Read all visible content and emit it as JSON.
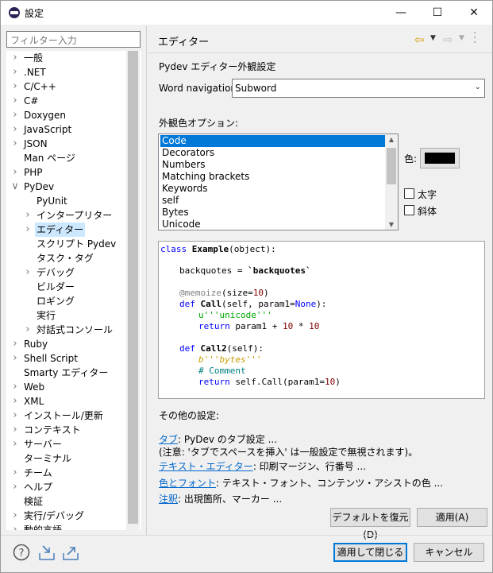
{
  "window": {
    "title": "設定"
  },
  "filter": {
    "placeholder": "フィルター入力"
  },
  "tree": [
    {
      "label": "一般",
      "arrow": ">",
      "indent": 0
    },
    {
      "label": ".NET",
      "arrow": ">",
      "indent": 0
    },
    {
      "label": "C/C++",
      "arrow": ">",
      "indent": 0
    },
    {
      "label": "C#",
      "arrow": ">",
      "indent": 0
    },
    {
      "label": "Doxygen",
      "arrow": ">",
      "indent": 0
    },
    {
      "label": "JavaScript",
      "arrow": ">",
      "indent": 0
    },
    {
      "label": "JSON",
      "arrow": ">",
      "indent": 0
    },
    {
      "label": "Man ページ",
      "arrow": "",
      "indent": 0
    },
    {
      "label": "PHP",
      "arrow": ">",
      "indent": 0
    },
    {
      "label": "PyDev",
      "arrow": "v",
      "indent": 0
    },
    {
      "label": "PyUnit",
      "arrow": "",
      "indent": 1
    },
    {
      "label": "インタープリター",
      "arrow": ">",
      "indent": 1
    },
    {
      "label": "エディター",
      "arrow": ">",
      "indent": 1,
      "selected": true
    },
    {
      "label": "スクリプト Pydev",
      "arrow": "",
      "indent": 1
    },
    {
      "label": "タスク・タグ",
      "arrow": "",
      "indent": 1
    },
    {
      "label": "デバッグ",
      "arrow": ">",
      "indent": 1
    },
    {
      "label": "ビルダー",
      "arrow": "",
      "indent": 1
    },
    {
      "label": "ロギング",
      "arrow": "",
      "indent": 1
    },
    {
      "label": "実行",
      "arrow": "",
      "indent": 1
    },
    {
      "label": "対話式コンソール",
      "arrow": ">",
      "indent": 1
    },
    {
      "label": "Ruby",
      "arrow": ">",
      "indent": 0
    },
    {
      "label": "Shell Script",
      "arrow": ">",
      "indent": 0
    },
    {
      "label": "Smarty エディター",
      "arrow": "",
      "indent": 0
    },
    {
      "label": "Web",
      "arrow": ">",
      "indent": 0
    },
    {
      "label": "XML",
      "arrow": ">",
      "indent": 0
    },
    {
      "label": "インストール/更新",
      "arrow": ">",
      "indent": 0
    },
    {
      "label": "コンテキスト",
      "arrow": ">",
      "indent": 0
    },
    {
      "label": "サーバー",
      "arrow": ">",
      "indent": 0
    },
    {
      "label": "ターミナル",
      "arrow": "",
      "indent": 0
    },
    {
      "label": "チーム",
      "arrow": ">",
      "indent": 0
    },
    {
      "label": "ヘルプ",
      "arrow": ">",
      "indent": 0
    },
    {
      "label": "検証",
      "arrow": "",
      "indent": 0
    },
    {
      "label": "実行/デバッグ",
      "arrow": ">",
      "indent": 0
    },
    {
      "label": "動的言語",
      "arrow": ">",
      "indent": 0
    }
  ],
  "header": {
    "title": "エディター"
  },
  "editor": {
    "section_title": "Pydev エディター外観設定",
    "word_nav_label": "Word navigation",
    "word_nav_value": "Subword",
    "color_options_label": "外観色オプション:",
    "color_options": [
      "Code",
      "Decorators",
      "Numbers",
      "Matching brackets",
      "Keywords",
      "self",
      "Bytes",
      "Unicode"
    ],
    "selected_option": "Code",
    "color_label": "色:",
    "color_value": "#000000",
    "bold_label": "太字",
    "italic_label": "斜体"
  },
  "preview": {
    "l1_kw": "class",
    "l1_cls": "Example",
    "l1_rest": "(object):",
    "l2_a": "backquotes = ",
    "l2_b": "`backquotes`",
    "l3_dec": "@memoize",
    "l3_a": "(size=",
    "l3_num": "10",
    "l3_b": ")",
    "l4_kw": "def",
    "l4_fn": "Call",
    "l4_a": "(self, param1=",
    "l4_none": "None",
    "l4_b": "):",
    "l5_str": "u'''unicode'''",
    "l6_kw": "return",
    "l6_a": " param1 + ",
    "l6_n1": "10",
    "l6_b": " * ",
    "l6_n2": "10",
    "l7_kw": "def",
    "l7_fn": "Call2",
    "l7_a": "(self):",
    "l8_bytes": "b'''bytes'''",
    "l9_cmt": "# Comment",
    "l10_kw": "return",
    "l10_a": " self.Call(param1=",
    "l10_num": "10",
    "l10_b": ")"
  },
  "other": {
    "label": "その他の設定:",
    "tab_link": "タブ",
    "tab_text": ": PyDev のタブ設定 ...",
    "note": "(注意: 'タブでスペースを挿入' は一般設定で無視されます)。",
    "text_editor_link": "テキスト・エディター",
    "text_editor_text": ": 印刷マージン、行番号 ...",
    "color_font_link": "色とフォント",
    "color_font_text": ": テキスト・フォント、コンテンツ・アシストの色 ...",
    "annot_link": "注釈",
    "annot_text": ": 出現箇所、マーカー ..."
  },
  "buttons": {
    "restore_defaults": "デフォルトを復元(D)",
    "apply": "適用(A)",
    "apply_close": "適用して閉じる",
    "cancel": "キャンセル"
  }
}
